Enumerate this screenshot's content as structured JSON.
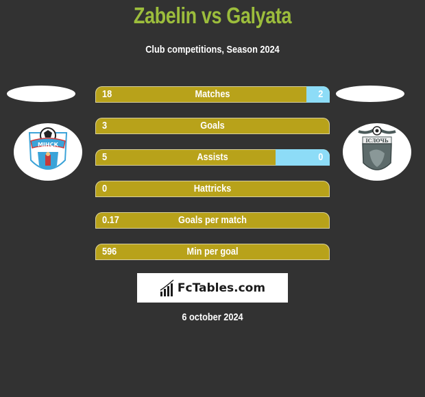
{
  "header": {
    "title": "Zabelin vs Galyata",
    "subtitle": "Club competitions, Season 2024"
  },
  "players": {
    "left": {
      "name": "Zabelin",
      "club_logo": "fc-minsk-crest",
      "logo_text": "МІНСК"
    },
    "right": {
      "name": "Galyata",
      "club_logo": "fc-isloch-crest",
      "logo_text": "ІСЛОЧЬ"
    }
  },
  "colors": {
    "background": "#323232",
    "title": "#9cbd3c",
    "left_bar": "#b8a21a",
    "right_bar": "#8ddcf7"
  },
  "stats": [
    {
      "label": "Matches",
      "left": "18",
      "right": "2",
      "right_share": 0.1
    },
    {
      "label": "Goals",
      "left": "3",
      "right": "",
      "right_share": 0
    },
    {
      "label": "Assists",
      "left": "5",
      "right": "0",
      "right_share": 0.23
    },
    {
      "label": "Hattricks",
      "left": "0",
      "right": "",
      "right_share": 0
    },
    {
      "label": "Goals per match",
      "left": "0.17",
      "right": "",
      "right_share": 0
    },
    {
      "label": "Min per goal",
      "left": "596",
      "right": "",
      "right_share": 0
    }
  ],
  "brand": {
    "text": "FcTables.com",
    "icon": "bar-chart-icon"
  },
  "date": "6 october 2024"
}
